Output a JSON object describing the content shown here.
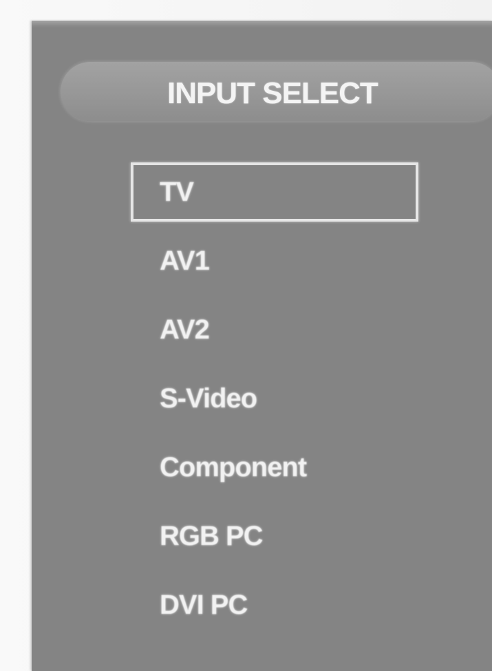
{
  "osd": {
    "title": "INPUT SELECT",
    "selected_index": 0,
    "items": [
      {
        "label": "TV"
      },
      {
        "label": "AV1"
      },
      {
        "label": "AV2"
      },
      {
        "label": "S-Video"
      },
      {
        "label": "Component"
      },
      {
        "label": "RGB PC"
      },
      {
        "label": "DVI PC"
      }
    ]
  },
  "colors": {
    "panel": "#848484",
    "title_bar": "#9a9a9a",
    "text": "#f2f2f2",
    "focus_border": "#e6e6e6"
  }
}
